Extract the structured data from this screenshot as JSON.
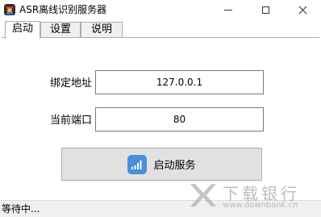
{
  "window": {
    "title": "ASR离线识别服务器",
    "controls": {
      "minimize": "minimize-icon",
      "maximize": "maximize-icon",
      "close": "close-icon"
    }
  },
  "tabs": [
    {
      "label": "启动",
      "active": true
    },
    {
      "label": "设置",
      "active": false
    },
    {
      "label": "说明",
      "active": false
    }
  ],
  "form": {
    "address_label": "绑定地址",
    "address_value": "127.0.0.1",
    "port_label": "当前端口",
    "port_value": "80"
  },
  "start_button": {
    "label": "启动服务",
    "icon": "signal-bars-icon",
    "icon_color": "#4a90d9"
  },
  "status": {
    "text": "等待中..."
  },
  "watermark": {
    "brand": "下载银行",
    "url": "www.downbank.cn"
  }
}
